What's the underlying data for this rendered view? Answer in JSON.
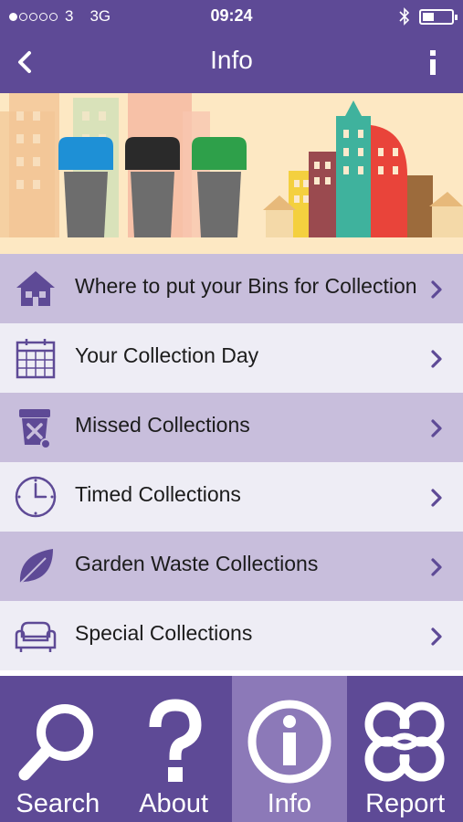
{
  "status_bar": {
    "carrier": "3",
    "network": "3G",
    "time": "09:24"
  },
  "nav": {
    "title": "Info"
  },
  "banner": {
    "bin_colors": [
      "#1e90d6",
      "#2a2a2a",
      "#2ea04a"
    ]
  },
  "menu": {
    "items": [
      {
        "label": "Where to put your Bins for Collection",
        "icon": "house-icon"
      },
      {
        "label": "Your Collection Day",
        "icon": "calendar-icon"
      },
      {
        "label": "Missed Collections",
        "icon": "crossed-bin-icon"
      },
      {
        "label": "Timed Collections",
        "icon": "clock-icon"
      },
      {
        "label": "Garden Waste Collections",
        "icon": "leaf-icon"
      },
      {
        "label": "Special Collections",
        "icon": "sofa-icon"
      }
    ]
  },
  "tabs": {
    "items": [
      {
        "label": "Search",
        "icon": "magnifier-icon",
        "active": false
      },
      {
        "label": "About",
        "icon": "question-mark-icon",
        "active": false
      },
      {
        "label": "Info",
        "icon": "info-icon",
        "active": true
      },
      {
        "label": "Report",
        "icon": "report-knot-icon",
        "active": false
      }
    ]
  },
  "colors": {
    "brand_purple": "#5e4a96",
    "row_highlight": "#c8bedc",
    "row_plain": "#eeedf5",
    "tab_active": "#8c79b8"
  }
}
